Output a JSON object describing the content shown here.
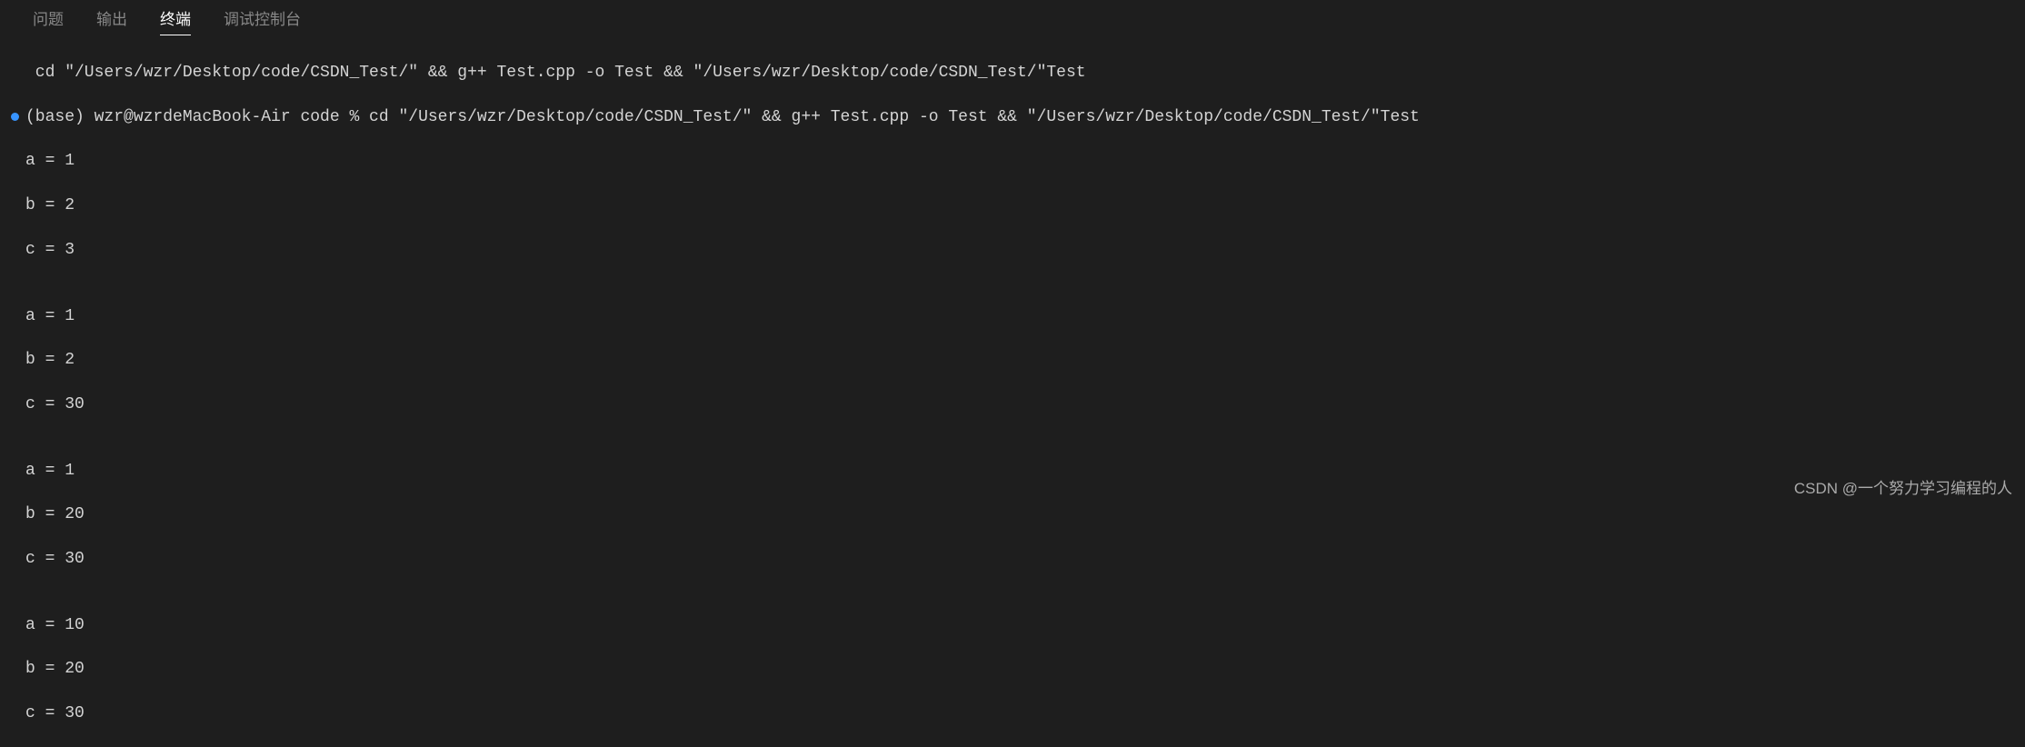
{
  "tabs": {
    "problems": "问题",
    "output": "输出",
    "terminal": "终端",
    "debug_console": "调试控制台"
  },
  "terminal": {
    "line1": " cd \"/Users/wzr/Desktop/code/CSDN_Test/\" && g++ Test.cpp -o Test && \"/Users/wzr/Desktop/code/CSDN_Test/\"Test",
    "line2": "(base) wzr@wzrdeMacBook-Air code % cd \"/Users/wzr/Desktop/code/CSDN_Test/\" && g++ Test.cpp -o Test && \"/Users/wzr/Desktop/code/CSDN_Test/\"Test",
    "out": [
      "a = 1",
      "b = 2",
      "c = 3",
      "",
      "a = 1",
      "b = 2",
      "c = 30",
      "",
      "a = 1",
      "b = 20",
      "c = 30",
      "",
      "a = 10",
      "b = 20",
      "c = 30"
    ]
  },
  "watermark": "CSDN @一个努力学习编程的人"
}
